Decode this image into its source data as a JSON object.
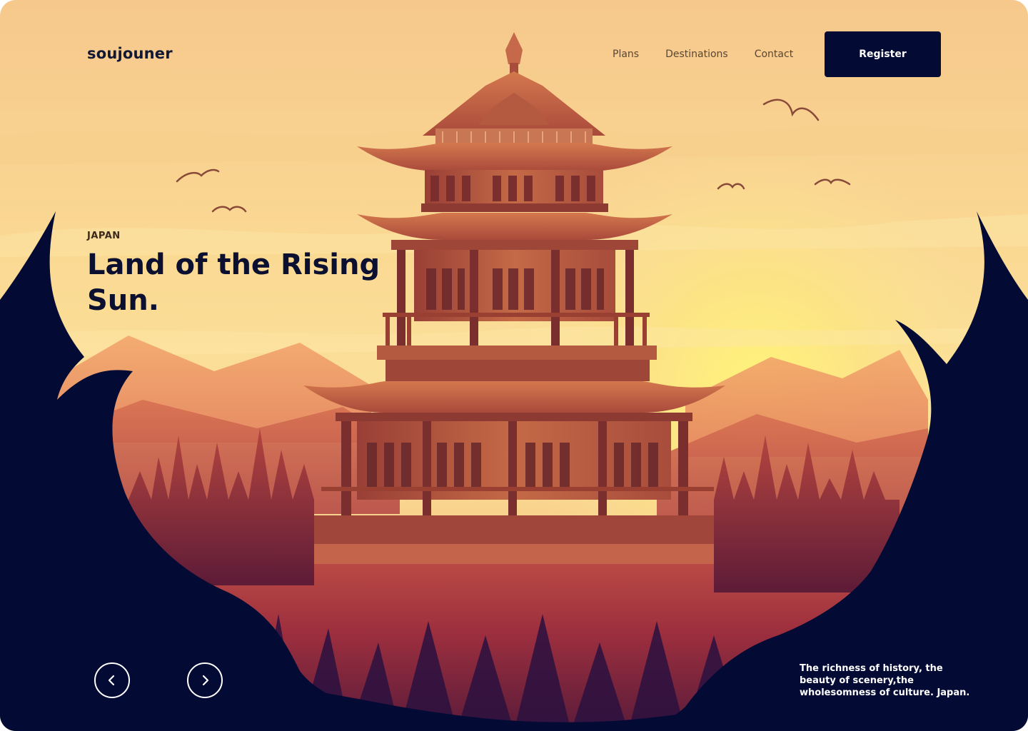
{
  "header": {
    "logo": "soujouner",
    "nav": [
      "Plans",
      "Destinations",
      "Contact"
    ],
    "register_label": "Register"
  },
  "hero": {
    "eyebrow": "JAPAN",
    "headline": "Land of the Rising Sun.",
    "tagline": "The richness of history, the beauty of scenery,the wholesomness of culture. Japan."
  },
  "carousel": {
    "prev_icon": "chevron-left-icon",
    "next_icon": "chevron-right-icon"
  },
  "colors": {
    "navy": "#030a34",
    "sky_top": "#f7c98d",
    "sky_mid": "#fbe29c",
    "sun": "#fff27a",
    "pagoda": "#b85a3c",
    "pagoda_dark": "#7a2f2e",
    "hill": "#8f2e3c",
    "text_dark": "#0b1030"
  }
}
